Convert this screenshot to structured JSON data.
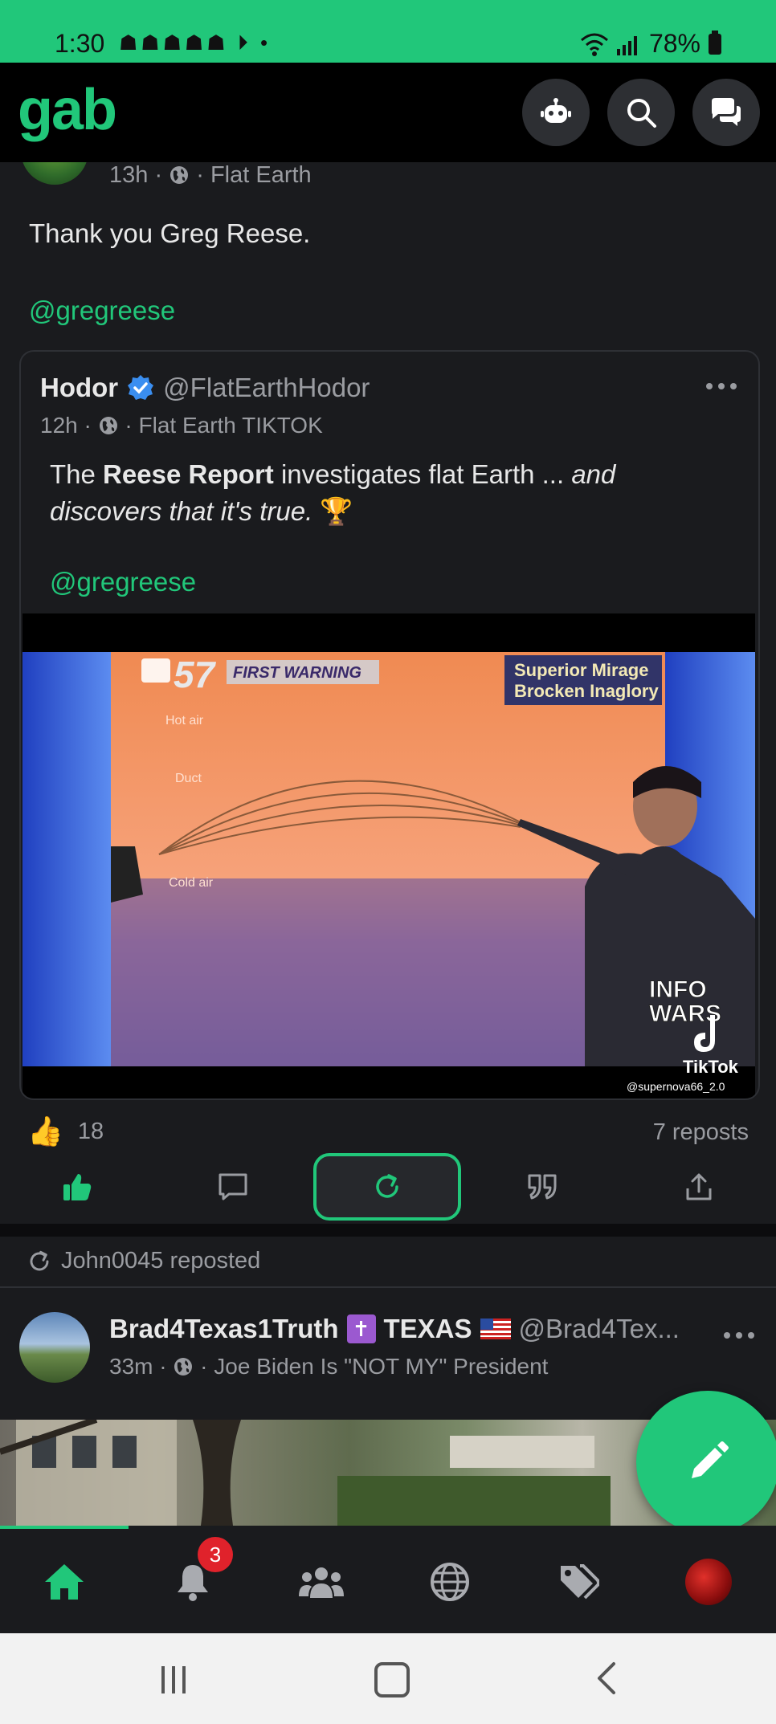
{
  "status_bar": {
    "time": "1:30",
    "notification_icons": "☗☗☗☗☗ ⏵ •",
    "battery": "78%"
  },
  "header": {
    "logo": "gab",
    "icons": [
      "bot-icon",
      "search-icon",
      "chat-icon"
    ]
  },
  "post": {
    "time": "13h",
    "group": "Flat Earth",
    "text": "Thank you Greg Reese.",
    "mention": "@gregreese",
    "quoted": {
      "author_name": "Hodor",
      "author_handle": "@FlatEarthHodor",
      "time": "12h",
      "group": "Flat Earth TIKTOK",
      "text_prefix": "The ",
      "text_bold": "Reese Report",
      "text_middle": " investigates flat Earth ... ",
      "text_italic": "and discovers that it's true.",
      "text_emoji": " 🏆",
      "mention": "@gregreese",
      "video": {
        "station": "57",
        "banner": "FIRST WARNING",
        "caption_line1": "Superior Mirage",
        "caption_line2": "Brocken Inaglory",
        "label_hot": "Hot air",
        "label_duct": "Duct",
        "label_cold": "Cold air",
        "watermark1": "INFO",
        "watermark2": "WARS",
        "tiktok": "TikTok",
        "tiktok_user": "@supernova66_2.0"
      }
    },
    "likes": "18",
    "reposts": "7 reposts"
  },
  "repost_banner": "John0045 reposted",
  "next_post": {
    "author_name": "Brad4Texas1Truth",
    "author_extra": "TEXAS",
    "author_handle": "@Brad4Tex...",
    "time": "33m",
    "group": "Joe Biden Is \"NOT MY\" President"
  },
  "bottom_nav": {
    "notifications_count": "3"
  },
  "colors": {
    "accent": "#21c77a",
    "background": "#1a1b1e"
  }
}
